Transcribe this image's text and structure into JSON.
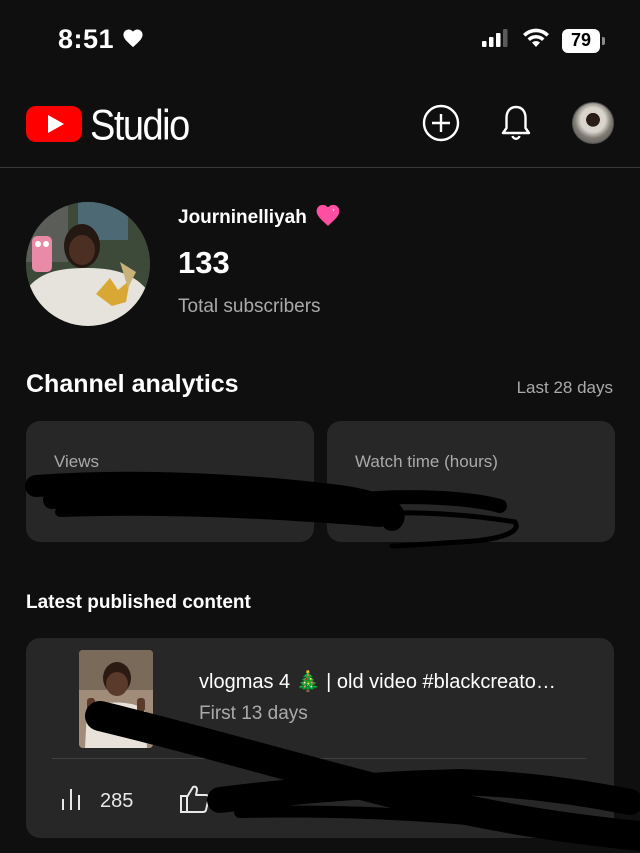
{
  "status_bar": {
    "time": "8:51",
    "battery": "79"
  },
  "header": {
    "app_name": "Studio"
  },
  "channel": {
    "name": "Journinelliyah",
    "subscriber_count": "133",
    "subscriber_label": "Total subscribers"
  },
  "analytics": {
    "title": "Channel analytics",
    "range": "Last 28 days",
    "metrics": [
      {
        "label": "Views",
        "value": ""
      },
      {
        "label": "Watch time (hours)",
        "value": ""
      }
    ]
  },
  "latest": {
    "title": "Latest published content",
    "video": {
      "title": "vlogmas 4 🎄 | old video #blackcreato…",
      "period": "First 13 days",
      "views": "285",
      "likes": ""
    }
  },
  "colors": {
    "background": "#0f0f0f",
    "card": "#272727",
    "secondary_text": "#aaaaaa",
    "youtube_red": "#ff0000",
    "heart_pink": "#ff4fa3"
  },
  "icons": [
    "heart-icon",
    "signal-icon",
    "wifi-icon",
    "battery-icon",
    "youtube-logo-icon",
    "create-icon",
    "bell-icon",
    "views-bar-chart-icon",
    "like-icon",
    "pink-heart-icon"
  ]
}
